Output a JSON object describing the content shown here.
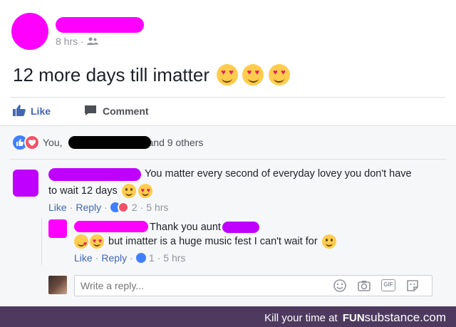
{
  "post": {
    "time": "8 hrs",
    "sep": "·",
    "text": "12 more days till imatter",
    "emojis": [
      "heart-eyes-emoji",
      "heart-eyes-emoji",
      "heart-eyes-emoji"
    ]
  },
  "actions": {
    "like": "Like",
    "comment": "Comment"
  },
  "reactions": {
    "you": "You,",
    "others": "and 9 others"
  },
  "comment1": {
    "text_line1": "You matter every second of everyday lovey you don't have",
    "text_line2": "to wait 12 days",
    "like": "Like",
    "reply": "Reply",
    "count": "2",
    "time": "5 hrs"
  },
  "reply1": {
    "line1": "Thank you aunt",
    "line2": "but imatter is a huge music fest I can't wait for",
    "like": "Like",
    "reply": "Reply",
    "count": "1",
    "time": "5 hrs"
  },
  "composer": {
    "placeholder": "Write a reply...",
    "gif_label": "GIF"
  },
  "footer": {
    "prefix": "Kill your time at",
    "brand_fun": "FUN",
    "brand_rest": "substance.com"
  },
  "colors": {
    "redact_magenta": "#ff00ff",
    "redact_purple": "#bf00ff",
    "link_blue": "#4267b2",
    "footer_bg": "#4e3a5f"
  }
}
